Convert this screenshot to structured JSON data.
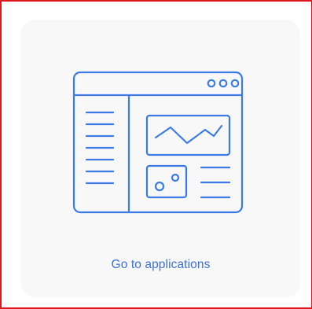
{
  "card": {
    "label": "Go to applications",
    "icon": "web-application-window-icon"
  },
  "colors": {
    "accent": "#3d6fdc",
    "icon_stroke": "#3b7be8",
    "card_background": "#f8f8f9",
    "frame_border": "#e0161f"
  }
}
